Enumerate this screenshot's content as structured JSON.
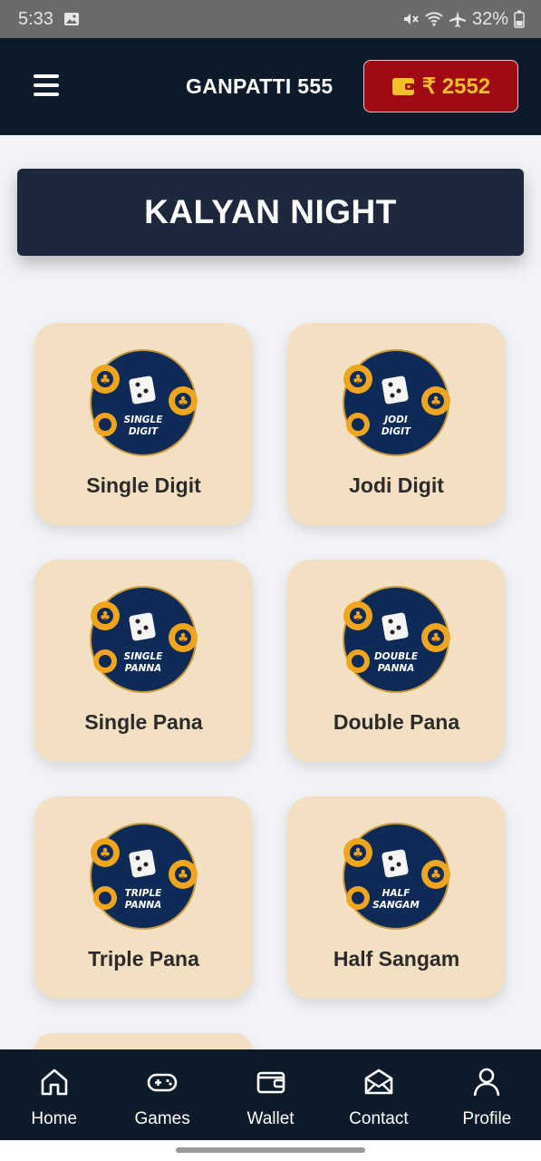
{
  "status_bar": {
    "time": "5:33",
    "battery": "32%"
  },
  "header": {
    "title": "GANPATTI 555",
    "wallet_amount": "₹ 2552",
    "menu_icon": "hamburger-icon",
    "wallet_icon": "wallet-icon"
  },
  "market": {
    "name": "KALYAN NIGHT"
  },
  "games": [
    {
      "label": "Single Digit",
      "badge_line1": "SINGLE",
      "badge_line2": "DIGIT"
    },
    {
      "label": "Jodi Digit",
      "badge_line1": "JODI",
      "badge_line2": "DIGIT"
    },
    {
      "label": "Single Pana",
      "badge_line1": "SINGLE",
      "badge_line2": "PANNA"
    },
    {
      "label": "Double Pana",
      "badge_line1": "DOUBLE",
      "badge_line2": "PANNA"
    },
    {
      "label": "Triple Pana",
      "badge_line1": "TRIPLE",
      "badge_line2": "PANNA"
    },
    {
      "label": "Half Sangam",
      "badge_line1": "HALF",
      "badge_line2": "SANGAM"
    }
  ],
  "bottom_nav": [
    {
      "label": "Home",
      "icon": "home-icon"
    },
    {
      "label": "Games",
      "icon": "gamepad-icon"
    },
    {
      "label": "Wallet",
      "icon": "wallet-icon"
    },
    {
      "label": "Contact",
      "icon": "mail-icon"
    },
    {
      "label": "Profile",
      "icon": "profile-icon"
    }
  ],
  "colors": {
    "header_bg": "#0d1a2a",
    "card_bg": "#f3e0c2",
    "wallet_bg": "#a10a12",
    "wallet_text": "#f3c027",
    "badge_bg": "#0e2a57",
    "chip": "#f0a51f"
  }
}
